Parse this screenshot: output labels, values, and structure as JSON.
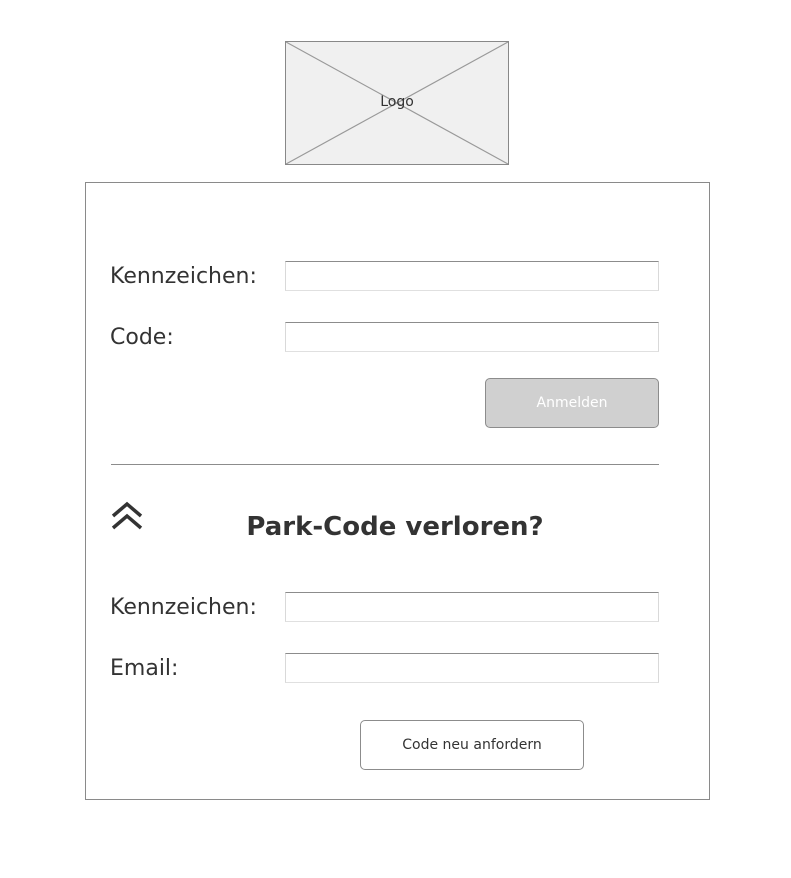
{
  "logo": {
    "label": "Logo"
  },
  "login": {
    "kennzeichen_label": "Kennzeichen:",
    "kennzeichen_value": "",
    "code_label": "Code:",
    "code_value": "",
    "submit_label": "Anmelden"
  },
  "recovery": {
    "collapse_icon": "double-chevron-up-icon",
    "title": "Park-Code verloren?",
    "kennzeichen_label": "Kennzeichen:",
    "kennzeichen_value": "",
    "email_label": "Email:",
    "email_value": "",
    "submit_label": "Code neu anfordern"
  },
  "colors": {
    "primary_button_bg": "#d0d0d0",
    "border": "#8c8c8c",
    "text": "#333333",
    "logo_bg": "#f0f0f0"
  }
}
